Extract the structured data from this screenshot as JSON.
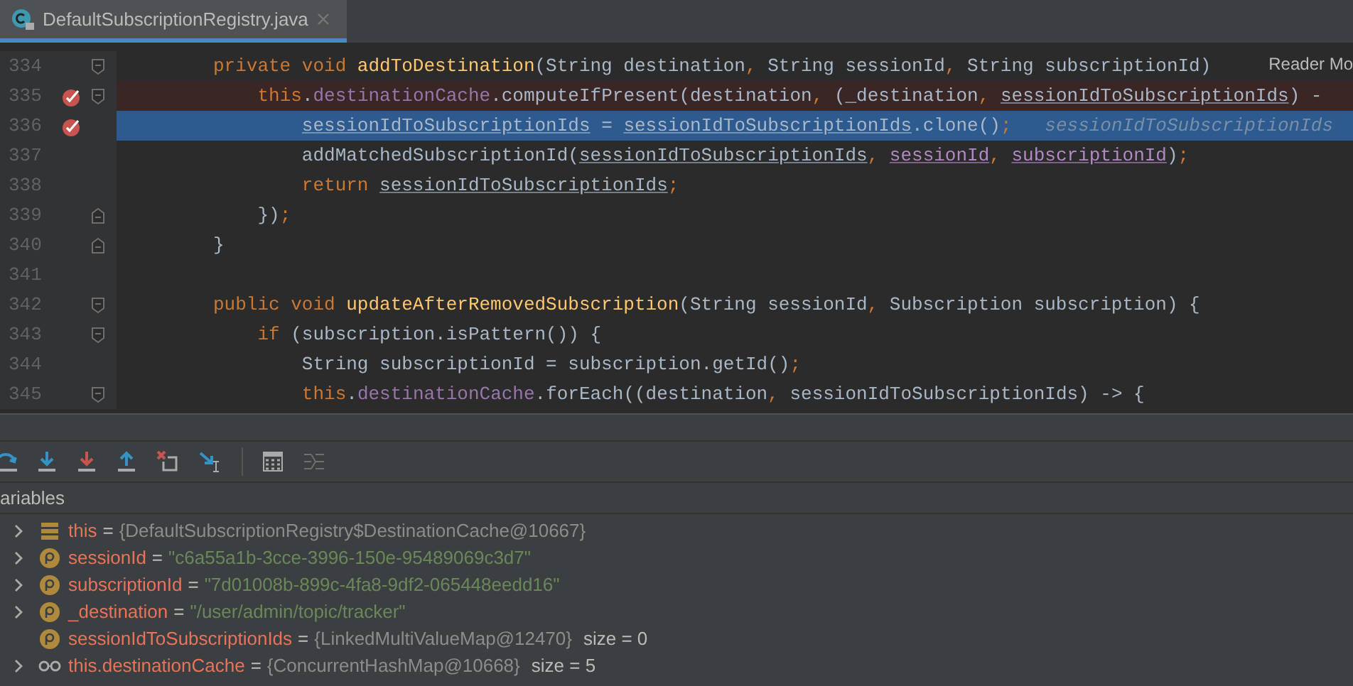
{
  "editor_tab": {
    "title": "DefaultSubscriptionRegistry.java",
    "selected": true
  },
  "reader_mode": "Reader Mo",
  "lines": [
    {
      "number": "334",
      "breakpoint": false,
      "current": false,
      "fold_start": true,
      "fold_end": false,
      "tokens": [
        {
          "t": "private void ",
          "kind": "keyword"
        },
        {
          "t": "addToDestination",
          "kind": "method"
        },
        {
          "t": "(String destination",
          "kind": "plain"
        },
        {
          "t": ", ",
          "kind": "punct"
        },
        {
          "t": "String sessionId",
          "kind": "plain"
        },
        {
          "t": ", ",
          "kind": "punct"
        },
        {
          "t": "String subscriptionId)",
          "kind": "plain"
        }
      ]
    },
    {
      "number": "335",
      "breakpoint": true,
      "current": false,
      "fold_start": true,
      "fold_end": false,
      "tokens": [
        {
          "t": "    this",
          "kind": "keyword"
        },
        {
          "t": ".",
          "kind": "plain"
        },
        {
          "t": "destinationCache",
          "kind": "field"
        },
        {
          "t": ".computeIfPresent(destination",
          "kind": "plain"
        },
        {
          "t": ", ",
          "kind": "punct"
        },
        {
          "t": "(_destination",
          "kind": "plain"
        },
        {
          "t": ", ",
          "kind": "punct"
        },
        {
          "t": "sessionIdToSubscriptionIds",
          "kind": "lambda"
        },
        {
          "t": ") -",
          "kind": "plain"
        }
      ]
    },
    {
      "number": "336",
      "breakpoint": true,
      "current": true,
      "fold_start": false,
      "fold_end": false,
      "tokens": [
        {
          "t": "        sessionIdToSubscriptionIds",
          "kind": "lambda"
        },
        {
          "t": " = ",
          "kind": "plain"
        },
        {
          "t": "sessionIdToSubscriptionIds",
          "kind": "lambda"
        },
        {
          "t": ".clone()",
          "kind": "plain"
        },
        {
          "t": ";",
          "kind": "punct"
        },
        {
          "t": "   sessionIdToSubscriptionIds",
          "kind": "hint"
        }
      ]
    },
    {
      "number": "337",
      "breakpoint": false,
      "current": false,
      "fold_start": false,
      "fold_end": false,
      "tokens": [
        {
          "t": "        addMatchedSubscriptionId(",
          "kind": "plain"
        },
        {
          "t": "sessionIdToSubscriptionIds",
          "kind": "lambda"
        },
        {
          "t": ", ",
          "kind": "punct"
        },
        {
          "t": "sessionId",
          "kind": "captured"
        },
        {
          "t": ", ",
          "kind": "punct"
        },
        {
          "t": "subscriptionId",
          "kind": "captured"
        },
        {
          "t": ")",
          "kind": "plain"
        },
        {
          "t": ";",
          "kind": "punct"
        }
      ]
    },
    {
      "number": "338",
      "breakpoint": false,
      "current": false,
      "fold_start": false,
      "fold_end": false,
      "tokens": [
        {
          "t": "        return ",
          "kind": "keyword"
        },
        {
          "t": "sessionIdToSubscriptionIds",
          "kind": "lambda"
        },
        {
          "t": ";",
          "kind": "punct"
        }
      ]
    },
    {
      "number": "339",
      "breakpoint": false,
      "current": false,
      "fold_start": false,
      "fold_end": true,
      "tokens": [
        {
          "t": "    })",
          "kind": "plain"
        },
        {
          "t": ";",
          "kind": "punct"
        }
      ]
    },
    {
      "number": "340",
      "breakpoint": false,
      "current": false,
      "fold_start": false,
      "fold_end": true,
      "tokens": [
        {
          "t": "}",
          "kind": "plain"
        }
      ]
    },
    {
      "number": "341",
      "breakpoint": false,
      "current": false,
      "fold_start": false,
      "fold_end": false
    },
    {
      "number": "342",
      "breakpoint": false,
      "current": false,
      "fold_start": true,
      "fold_end": false,
      "tokens": [
        {
          "t": "public void ",
          "kind": "keyword"
        },
        {
          "t": "updateAfterRemovedSubscription",
          "kind": "method"
        },
        {
          "t": "(String sessionId",
          "kind": "plain"
        },
        {
          "t": ", ",
          "kind": "punct"
        },
        {
          "t": "Subscription subscription) {",
          "kind": "plain"
        }
      ]
    },
    {
      "number": "343",
      "breakpoint": false,
      "current": false,
      "fold_start": true,
      "fold_end": false,
      "tokens": [
        {
          "t": "    if ",
          "kind": "keyword"
        },
        {
          "t": "(subscription.isPattern()) {",
          "kind": "plain"
        }
      ]
    },
    {
      "number": "344",
      "breakpoint": false,
      "current": false,
      "fold_start": false,
      "fold_end": false,
      "tokens": [
        {
          "t": "        String subscriptionId = subscription.getId()",
          "kind": "plain"
        },
        {
          "t": ";",
          "kind": "punct"
        }
      ]
    },
    {
      "number": "345",
      "breakpoint": false,
      "current": false,
      "fold_start": true,
      "fold_end": false,
      "tokens": [
        {
          "t": "        this",
          "kind": "keyword"
        },
        {
          "t": ".",
          "kind": "plain"
        },
        {
          "t": "destinationCache",
          "kind": "field"
        },
        {
          "t": ".forEach((destination",
          "kind": "plain"
        },
        {
          "t": ", ",
          "kind": "punct"
        },
        {
          "t": "sessionIdToSubscriptionIds) -> {",
          "kind": "plain"
        }
      ]
    }
  ],
  "debug_toolbar": [
    {
      "kind": "step-over",
      "disabled": false
    },
    {
      "kind": "step-into",
      "disabled": false
    },
    {
      "kind": "force-step-into",
      "disabled": false
    },
    {
      "kind": "step-out",
      "disabled": false
    },
    {
      "kind": "drop-frame",
      "disabled": false
    },
    {
      "kind": "run-to-cursor",
      "disabled": false
    },
    {
      "kind": "separator"
    },
    {
      "kind": "evaluate",
      "disabled": false
    },
    {
      "kind": "trace",
      "disabled": true
    }
  ],
  "variables": {
    "title": "ariables",
    "items": [
      {
        "kind": "object",
        "expandable": true,
        "name": "this",
        "operator": "=",
        "value": "{DefaultSubscriptionRegistry$DestinationCache@10667}",
        "is_string": false
      },
      {
        "kind": "param",
        "expandable": true,
        "name": "sessionId",
        "operator": "=",
        "value": "\"c6a55a1b-3cce-3996-150e-95489069c3d7\"",
        "is_string": true
      },
      {
        "kind": "param",
        "expandable": true,
        "name": "subscriptionId",
        "operator": "=",
        "value": "\"7d01008b-899c-4fa8-9df2-065448eedd16\"",
        "is_string": true
      },
      {
        "kind": "param",
        "expandable": true,
        "name": "_destination",
        "operator": "=",
        "value": "\"/user/admin/topic/tracker\"",
        "is_string": true
      },
      {
        "kind": "param",
        "expandable": false,
        "name": "sessionIdToSubscriptionIds",
        "operator": "=",
        "value": "{LinkedMultiValueMap@12470}",
        "is_string": false,
        "extra": "size = 0"
      },
      {
        "kind": "field",
        "expandable": true,
        "name": "this.destinationCache",
        "operator": "=",
        "value": "{ConcurrentHashMap@10668}",
        "is_string": false,
        "extra": "size = 5"
      }
    ]
  }
}
